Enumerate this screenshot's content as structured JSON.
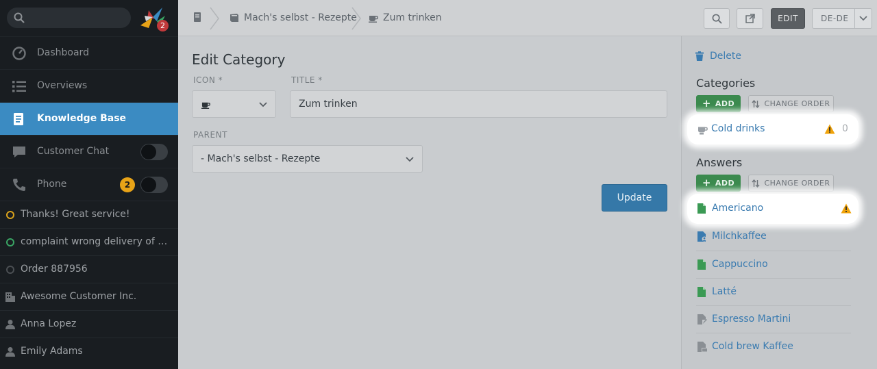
{
  "sidebar": {
    "logo_badge": "2",
    "nav": [
      {
        "label": "Dashboard"
      },
      {
        "label": "Overviews"
      },
      {
        "label": "Knowledge Base"
      },
      {
        "label": "Customer Chat"
      },
      {
        "label": "Phone",
        "badge": "2"
      }
    ],
    "tickets": [
      {
        "label": "Thanks! Great service!",
        "state": "open"
      },
      {
        "label": "complaint wrong delivery of order",
        "state": "new"
      },
      {
        "label": "Order 887956",
        "state": "closed"
      }
    ],
    "contacts": [
      {
        "label": "Awesome Customer Inc.",
        "icon": "building-icon"
      },
      {
        "label": "Anna Lopez",
        "icon": "person-icon"
      },
      {
        "label": "Emily Adams",
        "icon": "person-icon"
      }
    ]
  },
  "topbar": {
    "breadcrumbs": [
      {
        "label": "",
        "icon": "knowledge-base-icon"
      },
      {
        "label": "Mach's selbst - Rezepte",
        "icon": "book-icon"
      },
      {
        "label": "Zum trinken",
        "icon": "coffee-cup-icon"
      }
    ],
    "edit_label": "EDIT",
    "lang_label": "DE-DE"
  },
  "main": {
    "title": "Edit Category",
    "icon_label": "ICON *",
    "title_label": "TITLE *",
    "title_value": "Zum trinken",
    "parent_label": "PARENT",
    "parent_value": "- Mach's selbst - Rezepte",
    "update_label": "Update"
  },
  "panel": {
    "delete_label": "Delete",
    "categories_heading": "Categories",
    "add_label": "ADD",
    "change_order_label": "CHANGE ORDER",
    "categories": [
      {
        "label": "Cold drinks",
        "count": "0",
        "warning": true
      }
    ],
    "answers_heading": "Answers",
    "answers": [
      {
        "label": "Americano",
        "status": "published",
        "warning": true
      },
      {
        "label": "Milchkaffee",
        "status": "internal"
      },
      {
        "label": "Cappuccino",
        "status": "published"
      },
      {
        "label": "Latté",
        "status": "published"
      },
      {
        "label": "Espresso Martini",
        "status": "draft"
      },
      {
        "label": "Cold brew Kaffee",
        "status": "archived"
      }
    ]
  },
  "colors": {
    "accent": "#3b8bc2",
    "link": "#3a7bb0",
    "green": "#3b8a4e",
    "warning": "#f0a30a",
    "badge_red": "#c0393b"
  }
}
